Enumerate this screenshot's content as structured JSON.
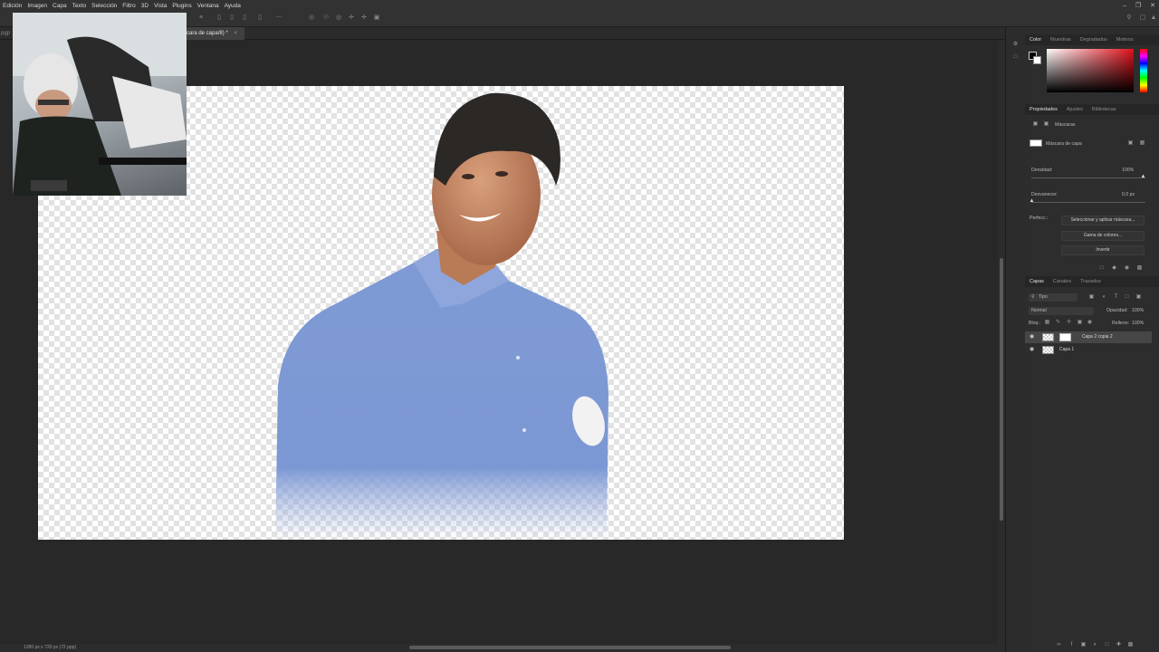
{
  "menu": {
    "items": [
      "Edición",
      "Imagen",
      "Capa",
      "Texto",
      "Selección",
      "Filtro",
      "3D",
      "Vista",
      "Plugins",
      "Ventana",
      "Ayuda"
    ]
  },
  "document": {
    "tab_title": "cara de capa/8) *",
    "left_tab_fragment": "pgp",
    "status": "1280 px x 720 px (72 ppp)"
  },
  "color_panel": {
    "tabs": [
      "Color",
      "Muestras",
      "Degradados",
      "Motivos"
    ],
    "foreground": "#000000",
    "background": "#ffffff",
    "hue_color": "#e0101a"
  },
  "properties_panel": {
    "tabs": [
      "Propiedades",
      "Ajustes",
      "Bibliotecas"
    ],
    "section_label": "Máscaras",
    "mask_label": "Máscara de capa",
    "density_label": "Densidad:",
    "density_value": "100%",
    "feather_label": "Desvanecer:",
    "feather_value": "0,0 px",
    "refine_label": "Perfecc.:",
    "btn_select_mask": "Seleccionar y aplicar máscara...",
    "btn_color_range": "Gama de colores...",
    "btn_invert": "Invertir"
  },
  "layers_panel": {
    "tabs": [
      "Capas",
      "Canales",
      "Trazados"
    ],
    "filter_label": "Tipo",
    "blend_mode": "Normal",
    "opacity_label": "Opacidad:",
    "opacity_value": "100%",
    "lock_label": "Bloq.:",
    "fill_label": "Relleno:",
    "fill_value": "100%",
    "layers": [
      {
        "name": "Capa 2 copia 2",
        "selected": true
      },
      {
        "name": "Capa 1",
        "selected": false
      }
    ]
  }
}
